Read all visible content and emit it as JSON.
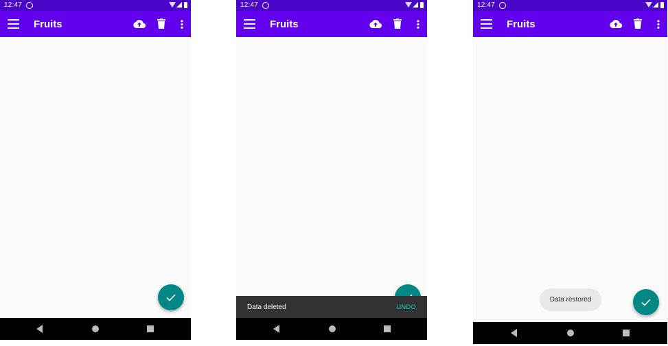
{
  "status_bar": {
    "time": "12:47"
  },
  "app_bar": {
    "title": "Fruits"
  },
  "snackbar": {
    "message": "Data deleted",
    "action": "UNDO"
  },
  "toast": {
    "message": "Data restored"
  },
  "colors": {
    "status_bar": "#4a05c9",
    "app_bar": "#6200ee",
    "fab": "#018786",
    "snackbar": "#323232",
    "snackbar_action": "#03dac5"
  },
  "icons": [
    "menu-icon",
    "cloud-upload-icon",
    "delete-icon",
    "overflow-menu-icon",
    "check-icon",
    "back-icon",
    "home-icon",
    "recents-icon"
  ]
}
